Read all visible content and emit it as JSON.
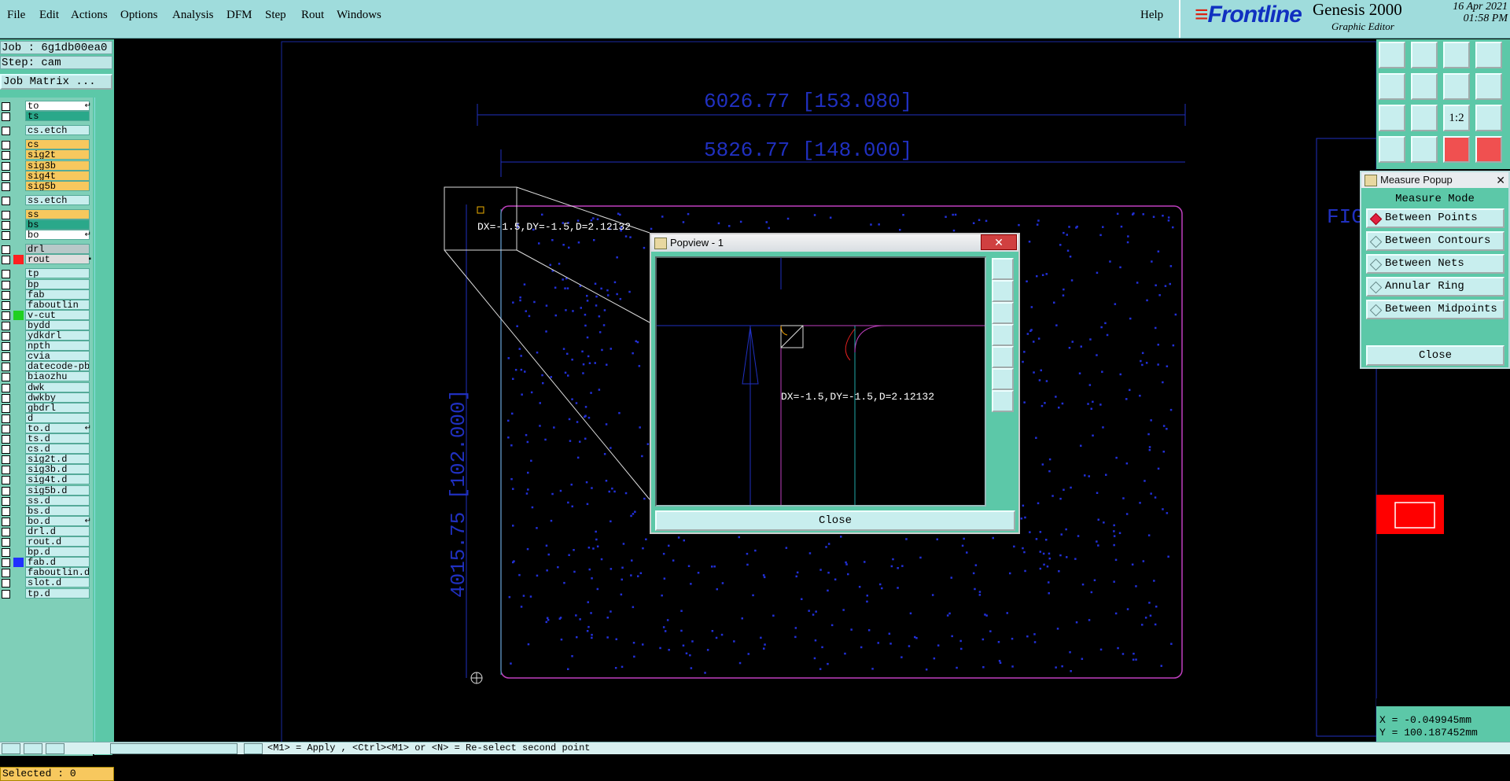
{
  "menu": [
    "File",
    "Edit",
    "Actions",
    "Options",
    "Analysis",
    "DFM",
    "Step",
    "Rout",
    "Windows"
  ],
  "help": "Help",
  "brand": {
    "name": "Frontline",
    "product": "Genesis 2000",
    "subtitle": "Graphic Editor",
    "date": "16 Apr 2021",
    "time": "01:58 PM"
  },
  "job": {
    "job_line": "Job : 6g1db00ea0",
    "step_line": "Step: cam",
    "matrix_button": "Job Matrix ..."
  },
  "layers": [
    {
      "name": "to",
      "color": "#ffffff",
      "marker": "↵"
    },
    {
      "name": "ts",
      "color": "#2aa88a"
    },
    {
      "name": "cs.etch",
      "color": "#c8eeee"
    },
    {
      "name": "cs",
      "color": "#f7c85e"
    },
    {
      "name": "sig2t",
      "color": "#f7c85e"
    },
    {
      "name": "sig3b",
      "color": "#f7c85e"
    },
    {
      "name": "sig4t",
      "color": "#f7c85e"
    },
    {
      "name": "sig5b",
      "color": "#f7c85e"
    },
    {
      "name": "ss.etch",
      "color": "#c8eeee"
    },
    {
      "name": "ss",
      "color": "#f7c85e"
    },
    {
      "name": "bs",
      "color": "#2aa88a"
    },
    {
      "name": "bo",
      "color": "#ffffff",
      "marker": "↵"
    },
    {
      "name": "drl",
      "color": "#b8c8c8"
    },
    {
      "name": "rout",
      "color": "#dddddd",
      "marker": "▪"
    },
    {
      "name": "tp",
      "color": "#c8eeee"
    },
    {
      "name": "bp",
      "color": "#c8eeee"
    },
    {
      "name": "fab",
      "color": "#c8eeee"
    },
    {
      "name": "faboutlin",
      "color": "#c8eeee"
    },
    {
      "name": "v-cut",
      "color": "#c8eeee"
    },
    {
      "name": "bydd",
      "color": "#c8eeee"
    },
    {
      "name": "ydkdrl",
      "color": "#c8eeee"
    },
    {
      "name": "npth",
      "color": "#c8eeee"
    },
    {
      "name": "cvia",
      "color": "#c8eeee"
    },
    {
      "name": "datecode-pbe",
      "color": "#c8eeee"
    },
    {
      "name": "biaozhu",
      "color": "#c8eeee"
    },
    {
      "name": "dwk",
      "color": "#c8eeee"
    },
    {
      "name": "dwkby",
      "color": "#c8eeee"
    },
    {
      "name": "gbdrl",
      "color": "#c8eeee"
    },
    {
      "name": "d",
      "color": "#c8eeee"
    },
    {
      "name": "to.d",
      "color": "#c8eeee",
      "marker": "↵"
    },
    {
      "name": "ts.d",
      "color": "#c8eeee"
    },
    {
      "name": "cs.d",
      "color": "#c8eeee"
    },
    {
      "name": "sig2t.d",
      "color": "#c8eeee"
    },
    {
      "name": "sig3b.d",
      "color": "#c8eeee"
    },
    {
      "name": "sig4t.d",
      "color": "#c8eeee"
    },
    {
      "name": "sig5b.d",
      "color": "#c8eeee"
    },
    {
      "name": "ss.d",
      "color": "#c8eeee"
    },
    {
      "name": "bs.d",
      "color": "#c8eeee"
    },
    {
      "name": "bo.d",
      "color": "#c8eeee",
      "marker": "↵"
    },
    {
      "name": "drl.d",
      "color": "#c8eeee"
    },
    {
      "name": "rout.d",
      "color": "#c8eeee"
    },
    {
      "name": "bp.d",
      "color": "#c8eeee"
    },
    {
      "name": "fab.d",
      "color": "#c8eeee"
    },
    {
      "name": "faboutlin.d",
      "color": "#c8eeee"
    },
    {
      "name": "slot.d",
      "color": "#c8eeee"
    },
    {
      "name": "tp.d",
      "color": "#c8eeee"
    }
  ],
  "layer_swatches": {
    "rout": "#ff2020",
    "v-cut": "#20d020",
    "fab.d": "#2030ff"
  },
  "selected": "Selected : 0",
  "canvas": {
    "dim_top_outer": "6026.77 [153.080]",
    "dim_top_inner": "5826.77 [148.000]",
    "dim_left": "4015.75 [102.000]",
    "measure_readout": "DX=-1.5,DY=-1.5,D=2.12132",
    "side_text": "FIG"
  },
  "popview": {
    "title": "Popview - 1",
    "readout": "DX=-1.5,DY=-1.5,D=2.12132",
    "close": "Close"
  },
  "measure": {
    "title": "Measure Popup",
    "mode_label": "Measure Mode",
    "options": [
      "Between Points",
      "Between Contours",
      "Between Nets",
      "Annular Ring",
      "Between Midpoints"
    ],
    "selected_option": "Between Points",
    "close": "Close"
  },
  "toolbar_icons": [
    "open-step-icon",
    "save-icon",
    "home-icon",
    "fit-window-icon",
    "import-icon",
    "export-icon",
    "undo-icon",
    "redo-icon",
    "zoom-fit-icon",
    "zoom-in-icon",
    "ratio-1-2",
    "help-icon",
    "measure-tool-icon",
    "snap-icon",
    "layers-red-icon",
    "layers-red-2-icon"
  ],
  "ratio_label": "1:2",
  "coords": {
    "x": "X = -0.049945mm",
    "y": "Y = 100.187452mm"
  },
  "status": "<M1> = Apply , <Ctrl><M1> or <N> = Re-select second point"
}
